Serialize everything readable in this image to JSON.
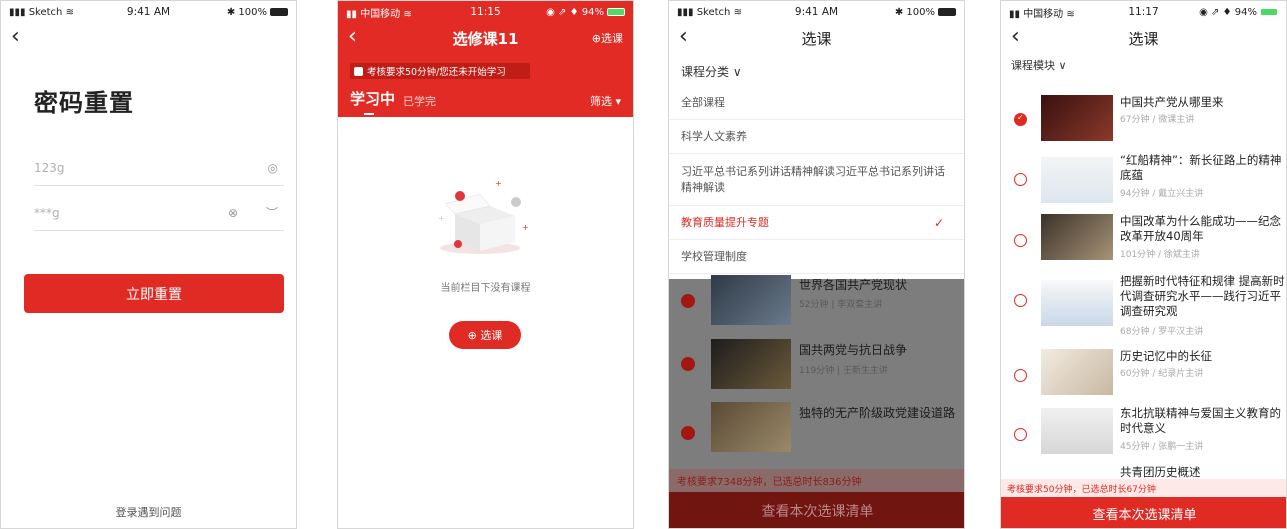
{
  "screen1": {
    "status": {
      "carrier": "Sketch",
      "time": "9:41 AM",
      "battery": "100%"
    },
    "title": "密码重置",
    "field1_value": "123g",
    "field2_value": "***g",
    "submit_label": "立即重置",
    "help_link": "登录遇到问题"
  },
  "screen2": {
    "status": {
      "carrier": "中国移动",
      "time": "11:15",
      "battery": "94%"
    },
    "nav_title": "选修课11",
    "nav_action": "⊕选课",
    "notice": "考核要求50分钟/您还未开始学习",
    "tab_active": "学习中",
    "tab_inactive": "已学完",
    "filter_label": "筛选 ▾",
    "empty_text": "当前栏目下没有课程",
    "select_button": "⊕ 选课"
  },
  "screen3": {
    "status": {
      "carrier": "Sketch",
      "time": "9:41 AM",
      "battery": "100%"
    },
    "nav_title": "选课",
    "category_title": "课程分类 ∨",
    "categories": [
      "全部课程",
      "科学人文素养",
      "习近平总书记系列讲话精神解读习近平总书记系列讲话精神解读",
      "教育质量提升专题",
      "学校管理制度"
    ],
    "courses": [
      {
        "title": "世界各国共产党现状",
        "meta": "52分钟 | 李双套主讲"
      },
      {
        "title": "国共两党与抗日战争",
        "meta": "119分钟 | 王新生主讲"
      },
      {
        "title": "独特的无产阶级政党建设道路",
        "meta": ""
      }
    ],
    "requirement": "考核要求7348分钟，已选总时长836分钟",
    "bottom_button": "查看本次选课清单"
  },
  "screen4": {
    "status": {
      "carrier": "中国移动",
      "time": "11:17",
      "battery": "94%"
    },
    "nav_title": "选课",
    "module_title": "课程模块 ∨",
    "courses": [
      {
        "title": "中国共产党从哪里来",
        "meta": "67分钟 / 微课主讲"
      },
      {
        "title": "“红船精神”：新长征路上的精神底蕴",
        "meta": "94分钟 / 戴立兴主讲"
      },
      {
        "title": "中国改革为什么能成功——纪念改革开放40周年",
        "meta": "101分钟 / 徐斌主讲"
      },
      {
        "title": "把握新时代特征和规律 提高新时代调查研究水平——践行习近平调查研究观",
        "meta": "68分钟 / 罗平汉主讲"
      },
      {
        "title": "历史记忆中的长征",
        "meta": "60分钟 / 纪录片主讲"
      },
      {
        "title": "东北抗联精神与爱国主义教育的时代意义",
        "meta": "45分钟 / 张鹏一主讲"
      },
      {
        "title": "共青团历史概述",
        "meta": ""
      }
    ],
    "requirement": "考核要求50分钟，已选总时长67分钟",
    "bottom_button": "查看本次选课清单"
  }
}
